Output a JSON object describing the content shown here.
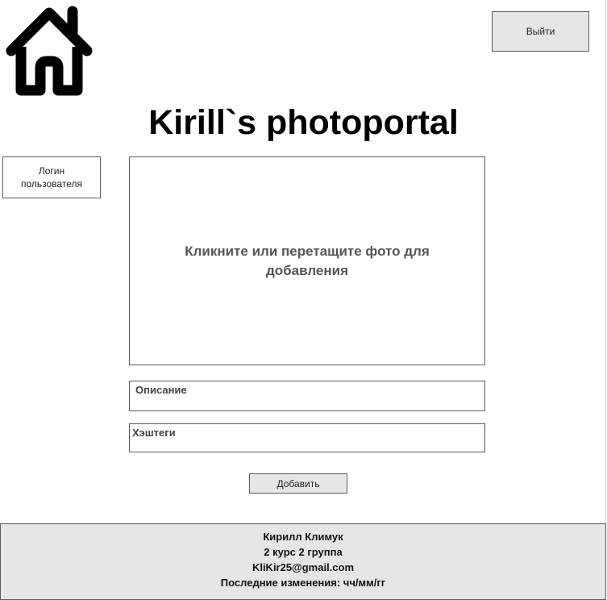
{
  "header": {
    "home_icon": "home-icon",
    "logout_label": "Выйти",
    "site_title": "Kirill`s photoportal"
  },
  "sidebar": {
    "user_login_label": "Логин пользователя"
  },
  "upload": {
    "dropzone_text": "Кликните или перетащите фото для добавления",
    "description_label": "Описание",
    "hashtags_label": "Хэштеги",
    "add_button_label": "Добавить"
  },
  "footer": {
    "author": "Кирилл Климук",
    "group": "2 курс 2 группа",
    "email": "KliKir25@gmail.com",
    "last_modified": "Последние изменения: чч/мм/гг"
  },
  "colors": {
    "button_bg": "#e6e6e6",
    "border": "#5a5a5a",
    "footer_bg": "#e6e6e6",
    "text": "#000000"
  }
}
